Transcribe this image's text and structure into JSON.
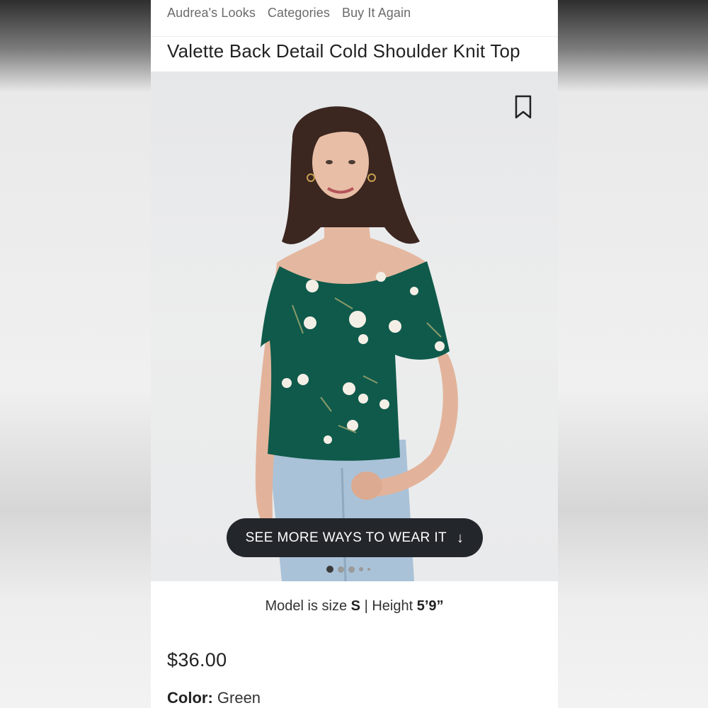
{
  "nav": {
    "links": [
      "Audrea's Looks",
      "Categories",
      "Buy It Again"
    ]
  },
  "product": {
    "title": "Valette Back Detail Cold Shoulder Knit Top",
    "price": "$36.00",
    "color_label": "Color:",
    "color_value": "Green"
  },
  "hero": {
    "bookmark_icon": "bookmark-icon",
    "cta_label": "SEE MORE WAYS TO WEAR IT",
    "cta_icon": "↓",
    "carousel_count": 5,
    "carousel_active": 1
  },
  "model_info": {
    "prefix": "Model is size",
    "size": "S",
    "separator": "|",
    "height_label": "Height",
    "height_value": "5’9”"
  },
  "colors": {
    "top_green": "#0f5a4b",
    "jeans": "#a9c2d8",
    "button": "#23262b"
  }
}
